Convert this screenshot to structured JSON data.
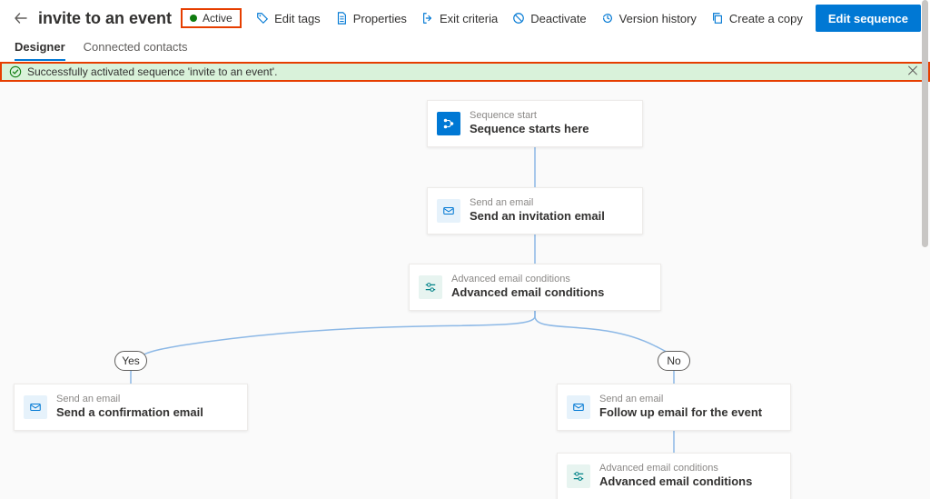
{
  "header": {
    "title": "invite to an event",
    "status_label": "Active",
    "buttons": {
      "edit_tags": "Edit tags",
      "properties": "Properties",
      "exit_criteria": "Exit criteria",
      "deactivate": "Deactivate",
      "version_history": "Version history",
      "create_copy": "Create a copy",
      "primary": "Edit sequence"
    }
  },
  "tabs": {
    "designer": "Designer",
    "connected": "Connected contacts"
  },
  "notification": {
    "message": "Successfully activated sequence 'invite to an event'."
  },
  "branches": {
    "yes": "Yes",
    "no": "No"
  },
  "nodes": {
    "start": {
      "caption": "Sequence start",
      "label": "Sequence starts here"
    },
    "email1": {
      "caption": "Send an email",
      "label": "Send an invitation email"
    },
    "cond1": {
      "caption": "Advanced email conditions",
      "label": "Advanced email conditions"
    },
    "emailYes": {
      "caption": "Send an email",
      "label": "Send a confirmation email"
    },
    "emailNo": {
      "caption": "Send an email",
      "label": "Follow up email for the event"
    },
    "cond2": {
      "caption": "Advanced email conditions",
      "label": "Advanced email conditions"
    }
  }
}
